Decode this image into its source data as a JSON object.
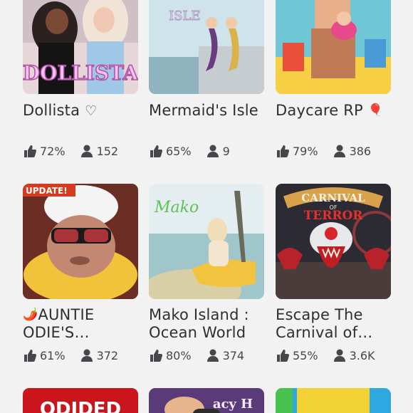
{
  "games": [
    {
      "id": "dollista",
      "title": "Dollista",
      "title_suffix": "♡",
      "thumb_text": "DOLLISTA",
      "like_pct": "72%",
      "players": "152"
    },
    {
      "id": "mermaids-isle",
      "title": "Mermaid's Isle",
      "thumb_text": "ISLE",
      "like_pct": "65%",
      "players": "9"
    },
    {
      "id": "daycare-rp",
      "title": "Daycare RP",
      "title_suffix": "🎈",
      "like_pct": "79%",
      "players": "386"
    },
    {
      "id": "auntie-odies",
      "title_prefix": "🌶️",
      "title_line1": "AUNTIE",
      "title_line2": "ODIE'S…",
      "thumb_badge": "UPDATE!",
      "like_pct": "61%",
      "players": "372"
    },
    {
      "id": "mako-island",
      "title_line1": "Mako Island :",
      "title_line2": "Ocean World",
      "thumb_text": "Mako",
      "like_pct": "80%",
      "players": "374"
    },
    {
      "id": "escape-carnival",
      "title_line1": "Escape The",
      "title_line2": "Carnival of…",
      "thumb_text_1": "CARNIVAL",
      "thumb_text_2": "OF",
      "thumb_text_3": "TERROR",
      "like_pct": "55%",
      "players": "3.6K"
    }
  ],
  "partial_row": [
    {
      "id": "partial-1",
      "thumb_text": "ODIDED"
    },
    {
      "id": "partial-2",
      "thumb_text": "acy H"
    },
    {
      "id": "partial-3"
    }
  ],
  "icons": {
    "like": "thumbs-up-icon",
    "players": "person-icon"
  },
  "colors": {
    "background": "#f2f2f3",
    "text": "#2d2f31",
    "stat_text": "#45474a"
  }
}
